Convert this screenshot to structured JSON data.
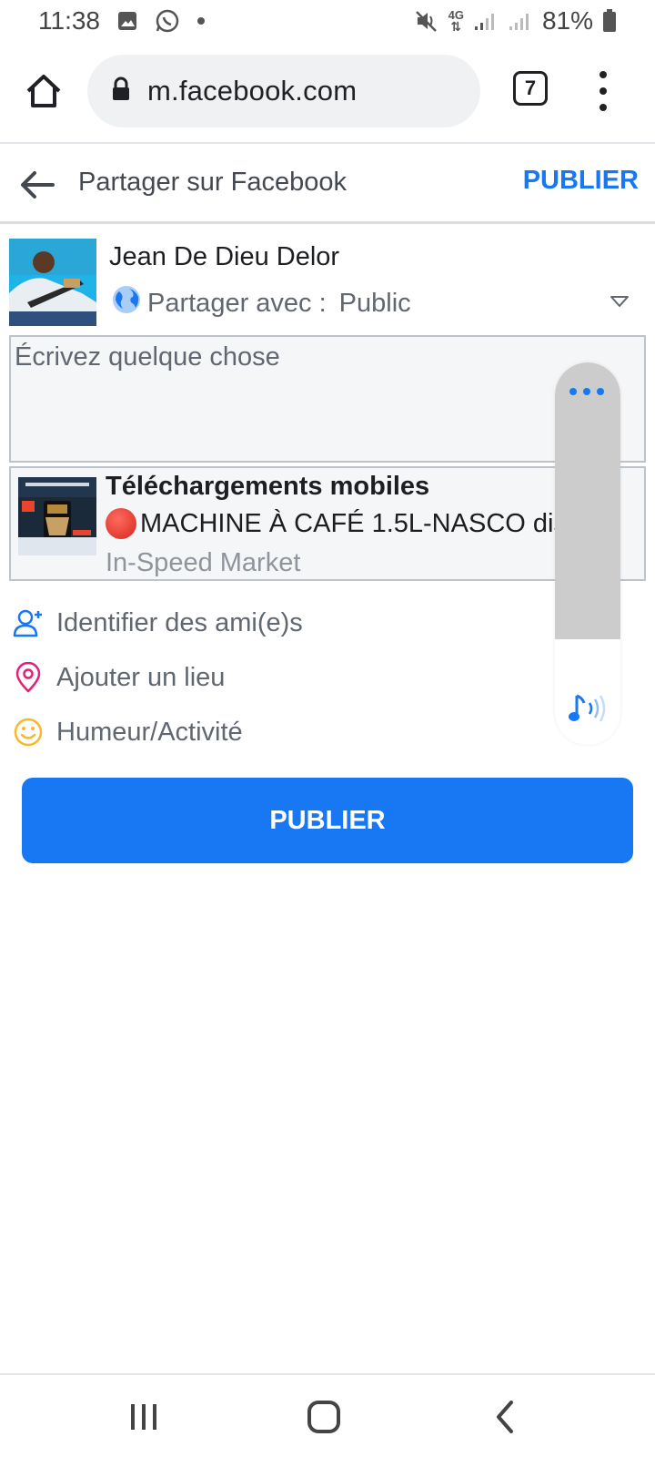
{
  "status_bar": {
    "time": "11:38",
    "battery": "81%",
    "network": "4G"
  },
  "browser": {
    "url": "m.facebook.com",
    "tab_count": "7"
  },
  "header": {
    "title": "Partager sur Facebook",
    "publish_label": "PUBLIER"
  },
  "composer": {
    "user_name": "Jean De Dieu Delor",
    "share_with_label": "Partager avec :",
    "audience": "Public",
    "placeholder": "Écrivez quelque chose"
  },
  "link_preview": {
    "title": "Téléchargements mobiles",
    "description": "MACHINE À CAFÉ 1.5L-NASCO dispo...",
    "source": "In-Speed Market"
  },
  "options": [
    {
      "label": "Identifier des ami(e)s",
      "icon": "add-friend-icon"
    },
    {
      "label": "Ajouter un lieu",
      "icon": "location-pin-icon"
    },
    {
      "label": "Humeur/Activité",
      "icon": "smiley-icon"
    }
  ],
  "publish_button_label": "PUBLIER",
  "colors": {
    "accent": "#1877f2",
    "location_icon": "#e41e79",
    "smiley_icon": "#f7b928"
  }
}
